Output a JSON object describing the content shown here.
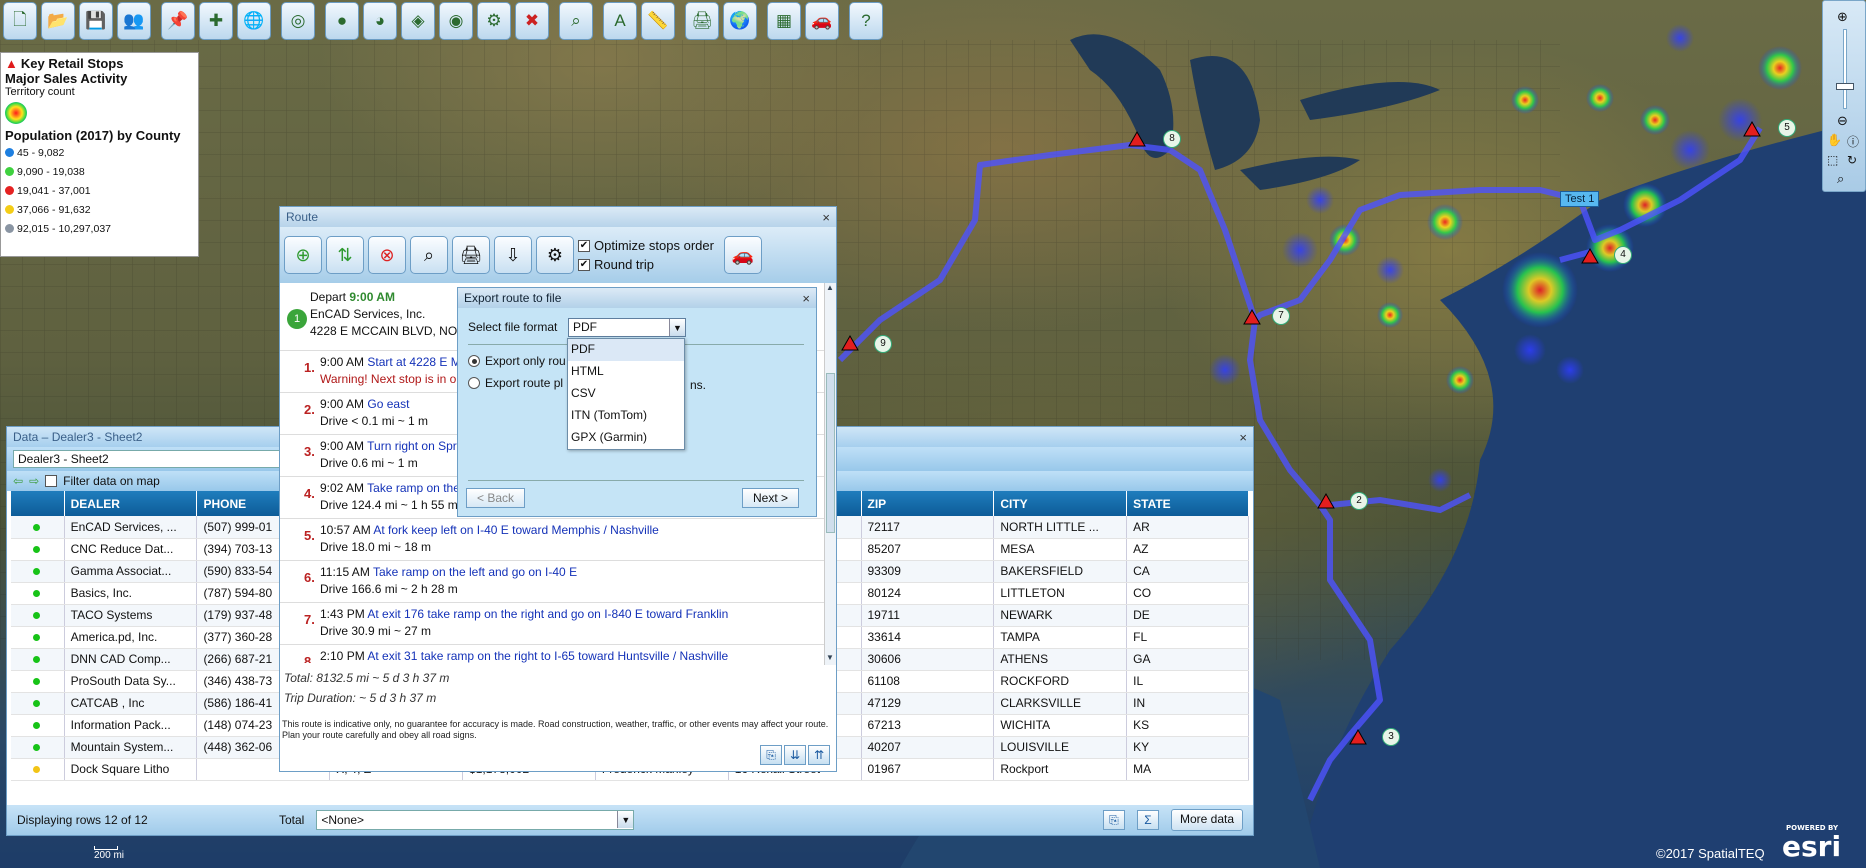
{
  "toolbar": {
    "icons": [
      "new-doc-icon",
      "open-folder-icon",
      "save-icon",
      "users-icon",
      "pushpin-icon",
      "puzzle-icon",
      "globe-icon",
      "target-icon",
      "bubbles-icon",
      "pie-icon",
      "layer-icon",
      "heatmap-icon",
      "tools-icon",
      "delete-icon",
      "lasso-icon",
      "label-icon",
      "ruler-icon",
      "print-icon",
      "globe-save-icon",
      "grid-icon",
      "route-car-icon",
      "help-icon"
    ]
  },
  "legend": {
    "layer1": "Key Retail Stops",
    "layer2": "Major Sales Activity",
    "layer2_sub": "Territory count",
    "layer3": "Population (2017) by County",
    "ranges": [
      {
        "label": "45 - 9,082",
        "color": "#1e7fe0"
      },
      {
        "label": "9,090 - 19,038",
        "color": "#3fd13f"
      },
      {
        "label": "19,041 - 37,001",
        "color": "#e52222"
      },
      {
        "label": "37,066 - 91,632",
        "color": "#f4cd17"
      },
      {
        "label": "92,015 - 10,297,037",
        "color": "#8a95a3"
      }
    ]
  },
  "map": {
    "stop_labels": [
      "8",
      "5",
      "Test 1",
      "4",
      "7",
      "9",
      "2",
      "3"
    ],
    "scale": "200 mi",
    "credit": "©2017 SpatialTEQ",
    "esri_powered": "POWERED BY",
    "esri_logo": "esri"
  },
  "data_panel": {
    "title": "Data – Dealer3 - Sheet2",
    "sheet": "Dealer3 - Sheet2",
    "filter_label": "Filter data on map",
    "columns": [
      "",
      "DEALER",
      "PHONE",
      "",
      "",
      "",
      "",
      "S",
      "ZIP",
      "CITY",
      "STATE"
    ],
    "rows": [
      {
        "dot": "#17c317",
        "dealer": "EnCAD Services, ...",
        "phone": "(507) 999-01",
        "c3": "",
        "c4": "",
        "c5": "",
        "c6": "",
        "addr": "CCAIN ...",
        "zip": "72117",
        "city": "NORTH LITTLE ...",
        "state": "AR"
      },
      {
        "dot": "#17c317",
        "dealer": "CNC Reduce Dat...",
        "phone": "(394) 703-13",
        "c3": "",
        "c4": "",
        "c5": "",
        "c6": "",
        "addr": "AIN ST",
        "zip": "85207",
        "city": "MESA",
        "state": "AZ"
      },
      {
        "dot": "#17c317",
        "dealer": "Gamma Associat...",
        "phone": "(590) 833-54",
        "c3": "",
        "c4": "",
        "c5": "",
        "c6": "",
        "addr": "ANZ RD",
        "zip": "93309",
        "city": "BAKERSFIELD",
        "state": "CA"
      },
      {
        "dot": "#17c317",
        "dealer": "Basics, Inc.",
        "phone": "(787) 594-80",
        "c3": "",
        "c4": "",
        "c5": "",
        "c6": "",
        "addr": "RK MEA...",
        "zip": "80124",
        "city": "LITTLETON",
        "state": "CO"
      },
      {
        "dot": "#17c317",
        "dealer": "TACO Systems",
        "phone": "(179) 937-48",
        "c3": "",
        "c4": "",
        "c5": "",
        "c6": "",
        "addr": "LEGE SQ",
        "zip": "19711",
        "city": "NEWARK",
        "state": "DE"
      },
      {
        "dot": "#17c317",
        "dealer": "America.pd, Inc.",
        "phone": "(377) 360-28",
        "c3": "",
        "c4": "",
        "c5": "",
        "c6": "",
        "addr": "HILLSBO...",
        "zip": "33614",
        "city": "TAMPA",
        "state": "FL"
      },
      {
        "dot": "#17c317",
        "dealer": "DNN CAD Comp...",
        "phone": "(266) 687-21",
        "c3": "",
        "c4": "",
        "c5": "",
        "c6": "",
        "addr": "LANTA H...",
        "zip": "30606",
        "city": "ATHENS",
        "state": "GA"
      },
      {
        "dot": "#17c317",
        "dealer": "ProSouth Data Sy...",
        "phone": "(346) 438-73",
        "c3": "",
        "c4": "",
        "c5": "",
        "c6": "",
        "addr": "TATE ST",
        "zip": "61108",
        "city": "ROCKFORD",
        "state": "IL"
      },
      {
        "dot": "#17c317",
        "dealer": "CATCAB , Inc",
        "phone": "(586) 186-41",
        "c3": "",
        "c4": "",
        "c5": "",
        "c6": "",
        "addr": "ANGLE ...",
        "zip": "47129",
        "city": "CLARKSVILLE",
        "state": "IN"
      },
      {
        "dot": "#17c317",
        "dealer": "Information Pack...",
        "phone": "(148) 074-23",
        "c3": "",
        "c4": "",
        "c5": "",
        "c6": "",
        "addr": "EST ST",
        "zip": "67213",
        "city": "WICHITA",
        "state": "KS"
      },
      {
        "dot": "#17c317",
        "dealer": "Mountain System...",
        "phone": "(448) 362-06",
        "c3": "",
        "c4": "",
        "c5": "",
        "c6": "",
        "addr": "ECKINR...",
        "zip": "40207",
        "city": "LOUISVILLE",
        "state": "KY"
      },
      {
        "dot": "#f2c416",
        "dealer": "Dock Square Litho",
        "phone": "",
        "c3": "X, Y, Z",
        "c4": "$1,178,002",
        "c5": "Frederick Manley",
        "c6": "",
        "addr": "16 Rexall Street",
        "zip": "01967",
        "city": "Rockport",
        "state": "MA"
      }
    ],
    "status": "Displaying rows 12 of 12",
    "total_label": "Total",
    "total_value": "<None>",
    "more_data": "More data"
  },
  "route_panel": {
    "title": "Route",
    "optimize_label": "Optimize stops order",
    "roundtrip_label": "Round trip",
    "depart_label": "Depart",
    "depart_time": "9:00 AM",
    "depart_company": "EnCAD Services, Inc.",
    "depart_address": "4228 E MCCAIN BLVD, NOR",
    "steps": [
      {
        "n": "1.",
        "time": "9:00 AM",
        "instr": "Start at 4228 E M",
        "detail": "Warning! Next stop is in o",
        "warn": true
      },
      {
        "n": "2.",
        "time": "9:00 AM",
        "instr": "Go east",
        "detail": "Drive < 0.1 mi ~ 1 m",
        "warn": false
      },
      {
        "n": "3.",
        "time": "9:00 AM",
        "instr": "Turn right on Spr",
        "detail": "Drive 0.6 mi ~ 1 m",
        "warn": false
      },
      {
        "n": "4.",
        "time": "9:02 AM",
        "instr": "Take ramp on the",
        "detail": "Drive 124.4 mi ~ 1 h 55 m",
        "warn": false
      },
      {
        "n": "5.",
        "time": "10:57 AM",
        "instr": "At fork keep left on I-40 E toward Memphis / Nashville",
        "detail": "Drive 18.0 mi ~ 18 m",
        "warn": false
      },
      {
        "n": "6.",
        "time": "11:15 AM",
        "instr": "Take ramp on the left and go on I-40 E",
        "detail": "Drive 166.6 mi ~ 2 h 28 m",
        "warn": false
      },
      {
        "n": "7.",
        "time": "1:43 PM",
        "instr": "At exit 176 take ramp on the right and go on I-840 E toward Franklin",
        "detail": "Drive 30.9 mi ~ 27 m",
        "warn": false
      },
      {
        "n": "8.",
        "time": "2:10 PM",
        "instr": "At exit 31 take ramp on the right to I-65 toward Huntsville / Nashville",
        "detail": "",
        "warn": false
      }
    ],
    "total": "Total: 8132.5 mi ~ 5 d 3 h 37 m",
    "duration": "Trip Duration: ~ 5 d 3 h 37 m",
    "disclaimer": "This route is indicative only, no guarantee for accuracy is made. Road construction, weather, traffic, or other events may affect your route. Plan your route carefully and obey all road signs."
  },
  "export_dialog": {
    "title": "Export route to file",
    "format_label": "Select file format",
    "format_value": "PDF",
    "option1": "Export only rou",
    "option2": "Export route pl",
    "option2_tail": "ns.",
    "back": "< Back",
    "next": "Next >",
    "formats": [
      "PDF",
      "HTML",
      "CSV",
      "ITN (TomTom)",
      "GPX (Garmin)"
    ]
  }
}
